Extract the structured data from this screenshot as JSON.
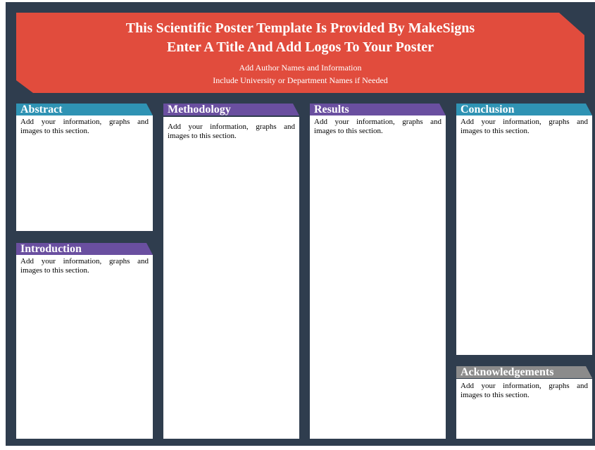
{
  "header": {
    "title_line1": "This Scientific Poster Template Is Provided By MakeSigns",
    "title_line2": "Enter A Title And Add Logos To Your Poster",
    "author_line": "Add Author Names and Information",
    "affiliation_line": "Include University or Department Names if Needed"
  },
  "sections": {
    "abstract": {
      "title": "Abstract",
      "body": "Add your information, graphs and images to this section."
    },
    "introduction": {
      "title": "Introduction",
      "body": "Add your information, graphs and images to this section."
    },
    "methodology": {
      "title": "Methodology",
      "body": "Add your information, graphs and images to this section."
    },
    "results": {
      "title": "Results",
      "body": "Add your information, graphs and images to this section."
    },
    "conclusion": {
      "title": "Conclusion",
      "body": "Add your information, graphs and images to this section."
    },
    "acknowledgements": {
      "title": "Acknowledgements",
      "body": "Add your information, graphs and images to this section."
    }
  },
  "colors": {
    "background": "#2f3d4e",
    "header": "#e14c3d",
    "teal_heading": "#2f93b4",
    "purple_heading": "#6a4fa0",
    "gray_heading": "#8b8b8b"
  }
}
